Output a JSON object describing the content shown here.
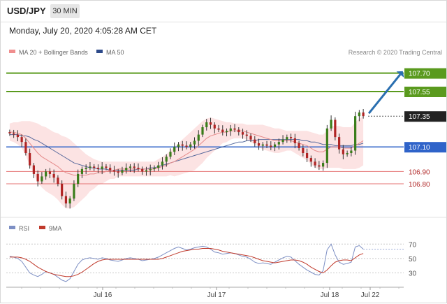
{
  "header": {
    "symbol": "USD/JPY",
    "timeframe": "30 MIN",
    "datetime": "Monday, July 20, 2020 4:05:28 AM CET"
  },
  "chart_data": [
    {
      "type": "candlestick",
      "title": "USD/JPY",
      "legend": [
        {
          "name": "MA 20 + Bollinger Bands",
          "color": "#f08e8e"
        },
        {
          "name": "MA 50",
          "color": "#2d4a8a"
        }
      ],
      "watermark": "Research © 2020 Trading Central",
      "ylim": [
        106.55,
        107.8
      ],
      "x_tick_labels": [
        "Jul 16",
        "Jul 17",
        "Jul 18",
        "Jul 22"
      ],
      "levels": [
        {
          "value": 107.7,
          "label": "107.70",
          "color": "#5a9a1e",
          "style": "target"
        },
        {
          "value": 107.55,
          "label": "107.55",
          "color": "#5a9a1e",
          "style": "target"
        },
        {
          "value": 107.35,
          "label": "107.35",
          "color": "#222222",
          "style": "last"
        },
        {
          "value": 107.1,
          "label": "107.10",
          "color": "#2f63c9",
          "style": "pivot"
        },
        {
          "value": 106.9,
          "label": "106.90",
          "color": "#b22b2b",
          "style": "support"
        },
        {
          "value": 106.8,
          "label": "106.80",
          "color": "#b22b2b",
          "style": "support"
        }
      ],
      "closes": [
        107.21,
        107.2,
        107.18,
        107.14,
        107.05,
        106.95,
        106.88,
        106.82,
        106.86,
        106.9,
        106.88,
        106.85,
        106.8,
        106.7,
        106.64,
        106.68,
        106.8,
        106.88,
        106.92,
        106.93,
        106.94,
        106.93,
        106.92,
        106.94,
        106.93,
        106.91,
        106.9,
        106.89,
        106.91,
        106.93,
        106.94,
        106.93,
        106.92,
        106.9,
        106.91,
        106.92,
        106.93,
        106.95,
        106.98,
        107.02,
        107.06,
        107.1,
        107.12,
        107.11,
        107.1,
        107.12,
        107.15,
        107.2,
        107.26,
        107.3,
        107.28,
        107.25,
        107.24,
        107.22,
        107.23,
        107.25,
        107.24,
        107.22,
        107.2,
        107.19,
        107.16,
        107.13,
        107.11,
        107.12,
        107.11,
        107.1,
        107.12,
        107.14,
        107.16,
        107.18,
        107.17,
        107.13,
        107.09,
        107.05,
        107.01,
        106.98,
        106.95,
        106.94,
        106.97,
        107.25,
        107.32,
        107.18,
        107.08,
        107.04,
        107.05,
        107.07,
        107.35,
        107.38,
        107.35
      ],
      "open_first": 107.22,
      "ma20": [
        107.22,
        107.22,
        107.21,
        107.2,
        107.17,
        107.13,
        107.09,
        107.05,
        107.02,
        107.0,
        106.98,
        106.96,
        106.94,
        106.91,
        106.89,
        106.88,
        106.87,
        106.87,
        106.87,
        106.87,
        106.88,
        106.88,
        106.89,
        106.89,
        106.9,
        106.91,
        106.91,
        106.92,
        106.92,
        106.92,
        106.92,
        106.92,
        106.92,
        106.92,
        106.92,
        106.92,
        106.92,
        106.93,
        106.94,
        106.95,
        106.97,
        106.98,
        107.0,
        107.02,
        107.04,
        107.06,
        107.08,
        107.11,
        107.14,
        107.17,
        107.19,
        107.2,
        107.21,
        107.22,
        107.22,
        107.23,
        107.23,
        107.23,
        107.23,
        107.22,
        107.21,
        107.2,
        107.19,
        107.18,
        107.17,
        107.16,
        107.15,
        107.15,
        107.15,
        107.15,
        107.15,
        107.14,
        107.13,
        107.12,
        107.11,
        107.09,
        107.07,
        107.06,
        107.06,
        107.08,
        107.1,
        107.1,
        107.1,
        107.09,
        107.09,
        107.09,
        107.11,
        107.13,
        107.15
      ],
      "band_width": [
        0.07,
        0.08,
        0.09,
        0.11,
        0.14,
        0.18,
        0.21,
        0.24,
        0.25,
        0.26,
        0.26,
        0.26,
        0.27,
        0.28,
        0.29,
        0.28,
        0.26,
        0.23,
        0.2,
        0.17,
        0.14,
        0.12,
        0.1,
        0.09,
        0.08,
        0.07,
        0.07,
        0.06,
        0.06,
        0.06,
        0.06,
        0.06,
        0.06,
        0.06,
        0.06,
        0.06,
        0.06,
        0.07,
        0.08,
        0.09,
        0.1,
        0.12,
        0.13,
        0.14,
        0.15,
        0.16,
        0.17,
        0.17,
        0.17,
        0.16,
        0.15,
        0.13,
        0.11,
        0.09,
        0.08,
        0.07,
        0.06,
        0.06,
        0.06,
        0.06,
        0.07,
        0.08,
        0.09,
        0.1,
        0.1,
        0.1,
        0.1,
        0.1,
        0.09,
        0.08,
        0.08,
        0.09,
        0.1,
        0.11,
        0.12,
        0.13,
        0.14,
        0.14,
        0.14,
        0.15,
        0.17,
        0.17,
        0.17,
        0.17,
        0.17,
        0.17,
        0.19,
        0.2,
        0.2
      ],
      "ma50": [
        107.2,
        107.2,
        107.2,
        107.19,
        107.19,
        107.18,
        107.16,
        107.15,
        107.13,
        107.11,
        107.09,
        107.07,
        107.05,
        107.03,
        107.01,
        106.99,
        106.97,
        106.96,
        106.95,
        106.94,
        106.93,
        106.93,
        106.92,
        106.92,
        106.92,
        106.91,
        106.91,
        106.91,
        106.91,
        106.91,
        106.91,
        106.91,
        106.92,
        106.92,
        106.92,
        106.93,
        106.93,
        106.94,
        106.95,
        106.96,
        106.97,
        106.98,
        106.99,
        107.0,
        107.01,
        107.02,
        107.03,
        107.04,
        107.05,
        107.06,
        107.07,
        107.08,
        107.09,
        107.1,
        107.11,
        107.12,
        107.13,
        107.14,
        107.14,
        107.15,
        107.15,
        107.15,
        107.16,
        107.16,
        107.16,
        107.16,
        107.16,
        107.16,
        107.16,
        107.16,
        107.16,
        107.16,
        107.16,
        107.15,
        107.15,
        107.14,
        107.14,
        107.13,
        107.12,
        107.12,
        107.12,
        107.11,
        107.11,
        107.11,
        107.11,
        107.11,
        107.12,
        107.12,
        107.13
      ]
    },
    {
      "type": "line",
      "legend": [
        {
          "name": "RSI",
          "color": "#7d8fc4"
        },
        {
          "name": "9MA",
          "color": "#c0392b"
        }
      ],
      "ylim": [
        15,
        80
      ],
      "y_ticks": [
        70,
        50,
        30
      ],
      "series": [
        {
          "name": "RSI",
          "color": "#7d8fc4",
          "values": [
            53,
            52,
            50,
            46,
            38,
            30,
            27,
            25,
            28,
            32,
            30,
            28,
            24,
            20,
            18,
            22,
            32,
            42,
            48,
            50,
            51,
            50,
            49,
            51,
            50,
            48,
            47,
            46,
            48,
            50,
            51,
            50,
            49,
            47,
            48,
            49,
            50,
            52,
            55,
            58,
            61,
            64,
            66,
            64,
            62,
            63,
            65,
            66,
            67,
            66,
            63,
            59,
            58,
            56,
            57,
            58,
            57,
            55,
            53,
            52,
            49,
            45,
            43,
            44,
            43,
            42,
            45,
            48,
            51,
            53,
            52,
            47,
            42,
            38,
            34,
            31,
            28,
            27,
            33,
            62,
            70,
            55,
            45,
            42,
            43,
            45,
            66,
            68,
            63
          ]
        },
        {
          "name": "9MA",
          "color": "#c0392b",
          "values": [
            52,
            52,
            52,
            51,
            49,
            46,
            42,
            38,
            35,
            32,
            30,
            28,
            27,
            26,
            25,
            25,
            26,
            28,
            31,
            35,
            39,
            43,
            46,
            48,
            49,
            49,
            49,
            49,
            49,
            49,
            49,
            49,
            49,
            49,
            49,
            49,
            49,
            49,
            50,
            52,
            54,
            56,
            58,
            60,
            61,
            62,
            63,
            63,
            64,
            64,
            64,
            63,
            62,
            60,
            59,
            58,
            57,
            56,
            55,
            54,
            53,
            51,
            49,
            47,
            46,
            45,
            44,
            45,
            46,
            47,
            48,
            48,
            47,
            45,
            42,
            38,
            35,
            32,
            30,
            34,
            40,
            45,
            47,
            48,
            48,
            47,
            51,
            55,
            57
          ]
        }
      ]
    }
  ]
}
